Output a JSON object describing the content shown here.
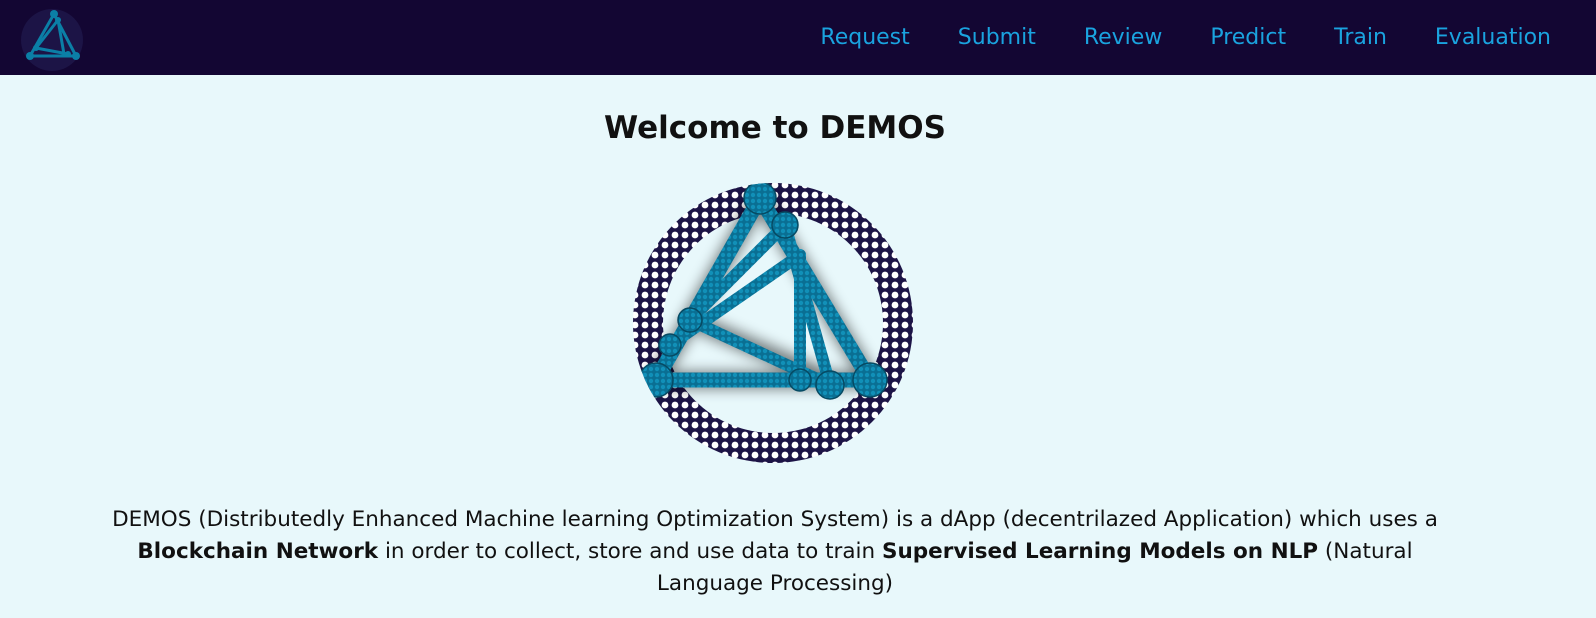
{
  "nav": {
    "logo": "demos-logo",
    "links": [
      "Request",
      "Submit",
      "Review",
      "Predict",
      "Train",
      "Evaluation"
    ]
  },
  "main": {
    "title": "Welcome to DEMOS",
    "hero_image": "demos-logo",
    "description": {
      "part1": "DEMOS (Distributedly Enhanced Machine learning Optimization System) is a dApp (decentrilazed Application) which uses a ",
      "bold1": "Blockchain Network",
      "part2": " in order to collect, store and use data to train ",
      "bold2": "Supervised Learning Models on NLP",
      "part3": " (Natural Language Processing)"
    }
  },
  "colors": {
    "navbar_bg": "#130633",
    "nav_link": "#1aa3df",
    "page_bg": "#e8f8fb",
    "logo_teal": "#0b7fa6",
    "logo_dark": "#1c1446"
  }
}
